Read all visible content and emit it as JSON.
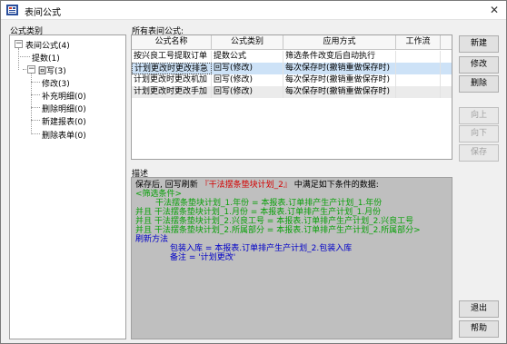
{
  "window": {
    "title": "表间公式",
    "close_glyph": "✕"
  },
  "left": {
    "label": "公式类别",
    "tree": [
      {
        "text": "表间公式(4)",
        "expander": "−"
      },
      {
        "text": "提数(1)"
      },
      {
        "text": "回写(3)",
        "expander": "−"
      },
      {
        "text": "修改(3)"
      },
      {
        "text": "补充明细(0)"
      },
      {
        "text": "删除明细(0)"
      },
      {
        "text": "新建报表(0)"
      },
      {
        "text": "删除表单(0)"
      }
    ]
  },
  "grid": {
    "label": "所有表间公式:",
    "headers": [
      "公式名称",
      "公式类别",
      "应用方式",
      "工作流"
    ],
    "rows": [
      [
        "按兴良工号提取订单",
        "提数公式",
        "筛选条件改变后自动执行",
        ""
      ],
      [
        "计划更改时更改排急",
        "回写(修改)",
        "每次保存时(撤销重做保存时)",
        ""
      ],
      [
        "计划更改时更改机加",
        "回写(修改)",
        "每次保存时(撤销重做保存时)",
        ""
      ],
      [
        "计划更改时更改手加",
        "回写(修改)",
        "每次保存时(撤销重做保存时)",
        ""
      ]
    ]
  },
  "buttons": {
    "new": "新建",
    "edit": "修改",
    "delete": "删除",
    "up": "向上",
    "down": "向下",
    "save": "保存",
    "exit": "退出",
    "help": "帮助"
  },
  "desc": {
    "label": "描述",
    "line1_a": "保存后,  回写刷新",
    "line1_b": "『干法摆条垫块计划_2』",
    "line1_c": "中满足如下条件的数据:",
    "filter_title": "<筛选条件>",
    "cond1": "干法摆条垫块计划_1.年份  =  本报表.订单排产生产计划_1.年份",
    "cond2": "并且  干法摆条垫块计划_1.月份  =  本报表.订单排产生产计划_1.月份",
    "cond3": "并且  干法摆条垫块计划_2.兴良工号  =  本报表.订单排产生产计划_2.兴良工号",
    "cond4": "并且  干法摆条垫块计划_2.所属部分  =  本报表.订单排产生产计划_2.所属部分>",
    "method_title": "刷新方法",
    "m1": "包装入库  =  本报表.订单排产生产计划_2.包装入库",
    "m2": "备注  =  '计划更改'"
  },
  "colors": {
    "selected_row": "#cde2f7",
    "desc_bg": "#bfbfbf",
    "green": "#08a008",
    "blue": "#0000c8",
    "red": "#d40000"
  }
}
